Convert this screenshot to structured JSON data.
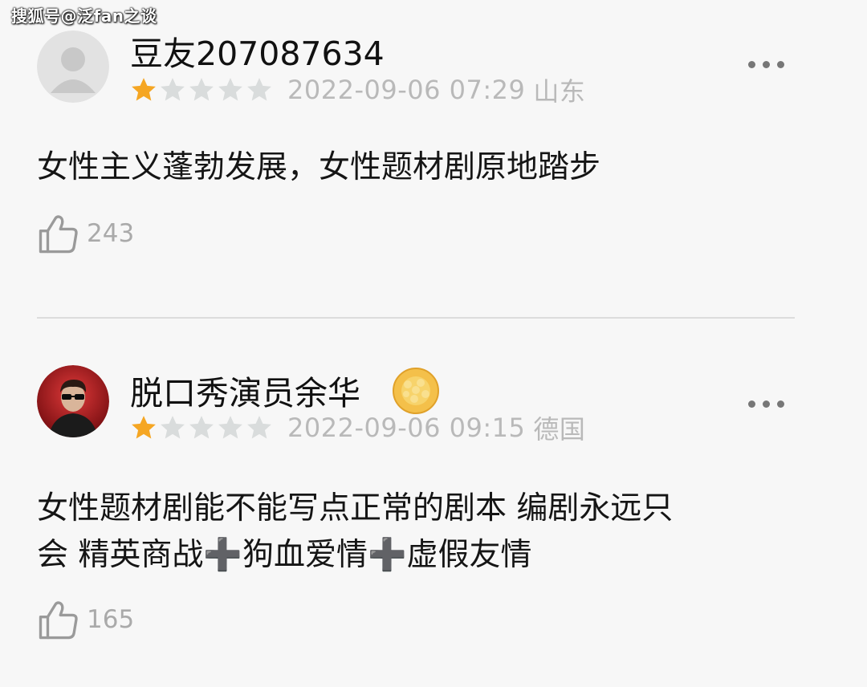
{
  "watermark": "搜狐号@泛fan之谈",
  "comments": [
    {
      "username": "豆友207087634",
      "rating": 1,
      "max_rating": 5,
      "datetime": "2022-09-06 07:29",
      "location": "山东",
      "text": "女性主义蓬勃发展，女性题材剧原地踏步",
      "likes": "243",
      "avatar": "default-avatar"
    },
    {
      "username": "脱口秀演员余华",
      "rating": 1,
      "max_rating": 5,
      "datetime": "2022-09-06 09:15",
      "location": "德国",
      "text_line1": "女性题材剧能不能写点正常的剧本 编剧永远只",
      "text_line2": "会 精英商战➕狗血爱情➕虚假友情",
      "likes": "165",
      "avatar": "photo-avatar",
      "badge": "pineapple-bun-badge"
    }
  ],
  "colors": {
    "star_filled": "#f5a623",
    "star_empty": "#d9dcdc",
    "meta_text": "#b9b9b9",
    "background": "#f7f7f7"
  }
}
